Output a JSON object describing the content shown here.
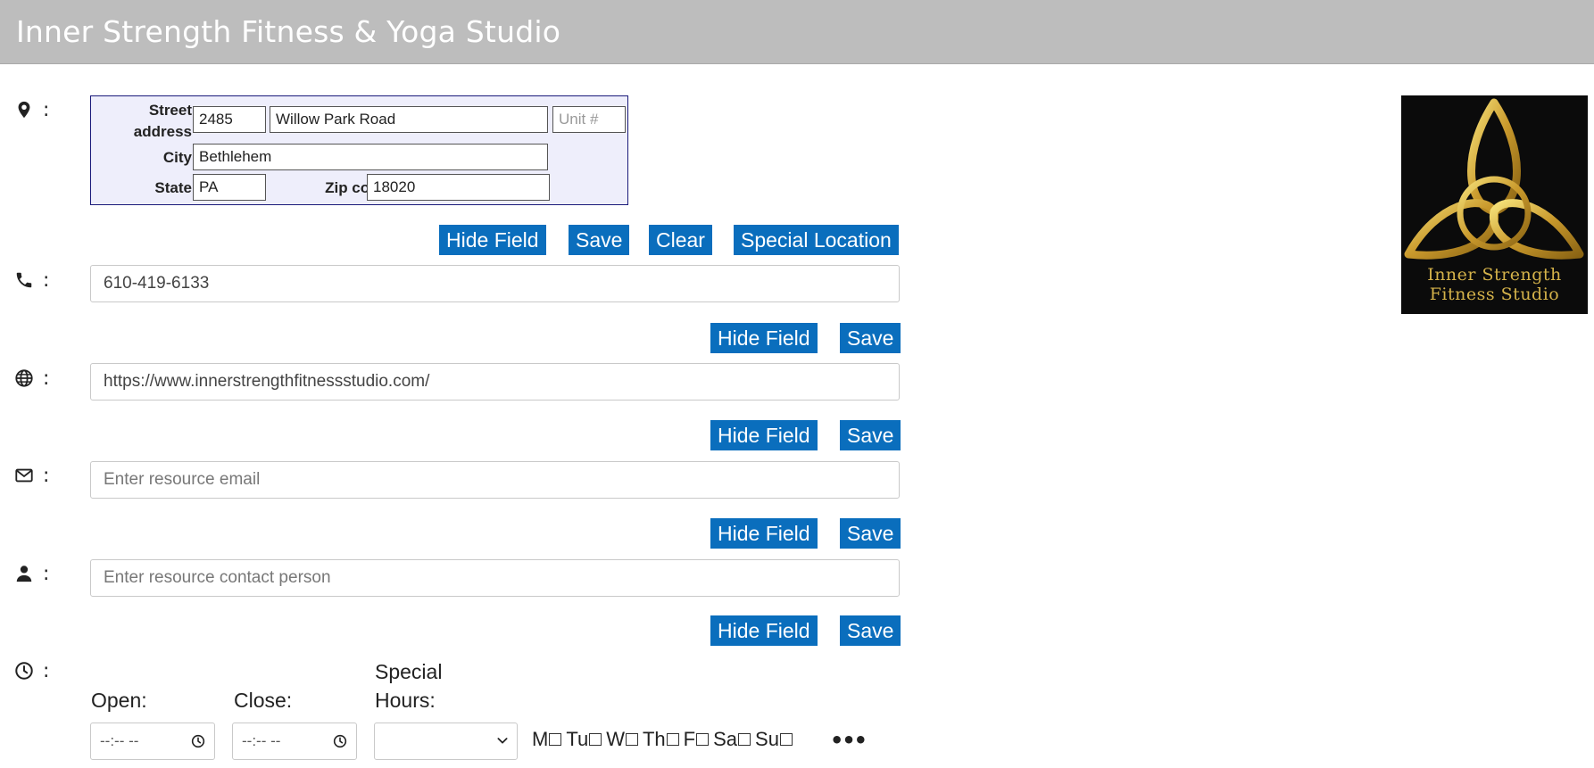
{
  "header": {
    "title": "Inner Strength Fitness & Yoga Studio"
  },
  "logo": {
    "line1": "Inner Strength",
    "line2": "Fitness Studio"
  },
  "address": {
    "street_label": "Street address",
    "street_number": "2485",
    "street_name": "Willow Park Road",
    "unit_placeholder": "Unit #",
    "city_label": "City",
    "city": "Bethlehem",
    "state_label": "State",
    "state": "PA",
    "zip_label": "Zip code",
    "zip": "18020"
  },
  "address_buttons": {
    "hide": "Hide Field",
    "save": "Save",
    "clear": "Clear",
    "special": "Special Location"
  },
  "colon": ":",
  "phone": {
    "value": "610-419-6133",
    "hide": "Hide Field",
    "save": "Save"
  },
  "website": {
    "value": "https://www.innerstrengthfitnessstudio.com/",
    "hide": "Hide Field",
    "save": "Save"
  },
  "email": {
    "placeholder": "Enter resource email",
    "hide": "Hide Field",
    "save": "Save"
  },
  "contact": {
    "placeholder": "Enter resource contact person",
    "hide": "Hide Field",
    "save": "Save"
  },
  "hours": {
    "open_label": "Open:",
    "close_label": "Close:",
    "special_label_1": "Special",
    "special_label_2": "Hours:",
    "open_value": "--:-- --",
    "close_value": "--:-- --",
    "days": [
      "M",
      "Tu",
      "W",
      "Th",
      "F",
      "Sa",
      "Su"
    ],
    "more": "•••"
  },
  "colors": {
    "button": "#0a6ebd",
    "header": "#bdbdbd",
    "address_bg": "#eeeefb",
    "logo_gold": "#d4b24a"
  }
}
